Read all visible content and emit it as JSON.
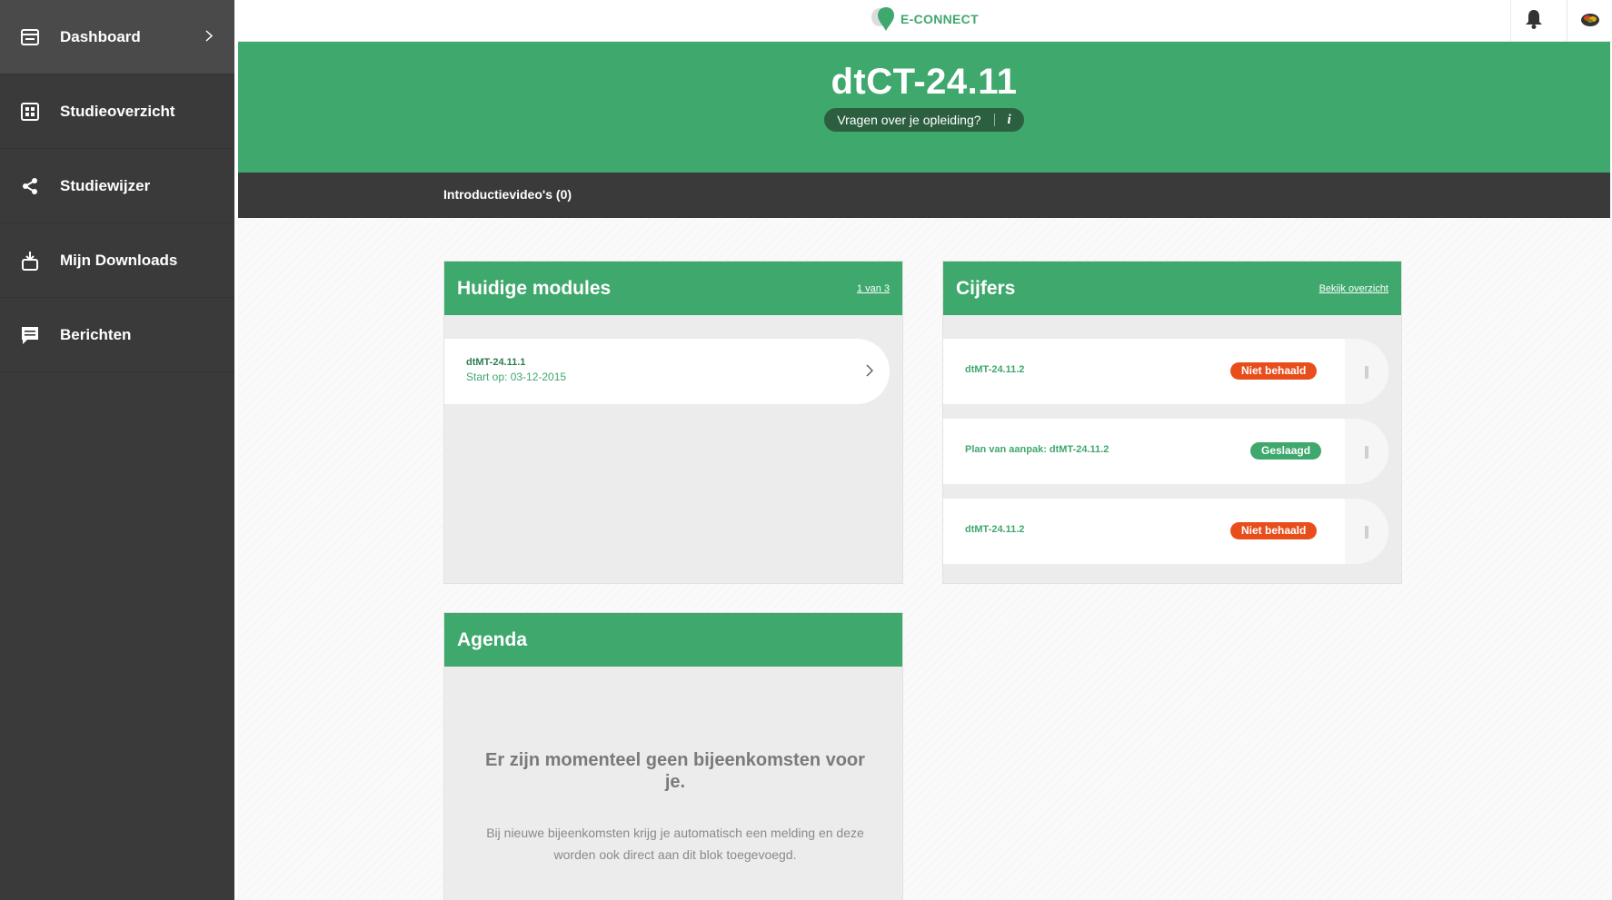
{
  "sidebar": {
    "items": [
      {
        "label": "Dashboard",
        "icon": "dashboard-icon"
      },
      {
        "label": "Studieoverzicht",
        "icon": "grid-icon"
      },
      {
        "label": "Studiewijzer",
        "icon": "share-icon"
      },
      {
        "label": "Mijn Downloads",
        "icon": "download-icon"
      },
      {
        "label": "Berichten",
        "icon": "message-icon"
      }
    ]
  },
  "topbar": {
    "logo_text": "E-CONNECT"
  },
  "hero": {
    "title": "dtCT-24.11",
    "question": "Vragen over je opleiding?",
    "info_glyph": "i"
  },
  "subnav": {
    "item": "Introductievideo's (0)"
  },
  "modules_card": {
    "title": "Huidige modules",
    "pager": "1 van 3",
    "module": {
      "name": "dtMT-24.11.1",
      "start": "Start op: 03-12-2015"
    }
  },
  "grades_card": {
    "title": "Cijfers",
    "link": "Bekijk overzicht",
    "rows": [
      {
        "name": "dtMT-24.11.2",
        "status": "Niet behaald",
        "status_color": "#e84e1b"
      },
      {
        "name": "Plan van aanpak: dtMT-24.11.2",
        "status": "Geslaagd",
        "status_color": "#3fa86d"
      },
      {
        "name": "dtMT-24.11.2",
        "status": "Niet behaald",
        "status_color": "#e84e1b"
      }
    ]
  },
  "agenda_card": {
    "title": "Agenda",
    "empty_title": "Er zijn momenteel geen bijeenkomsten voor je.",
    "empty_text": "Bij nieuwe bijeenkomsten krijg je automatisch een melding en deze worden ook direct aan dit blok toegevoegd."
  },
  "colors": {
    "accent": "#3fa86d",
    "sidebar": "#3a3a3a",
    "fail": "#e84e1b"
  }
}
